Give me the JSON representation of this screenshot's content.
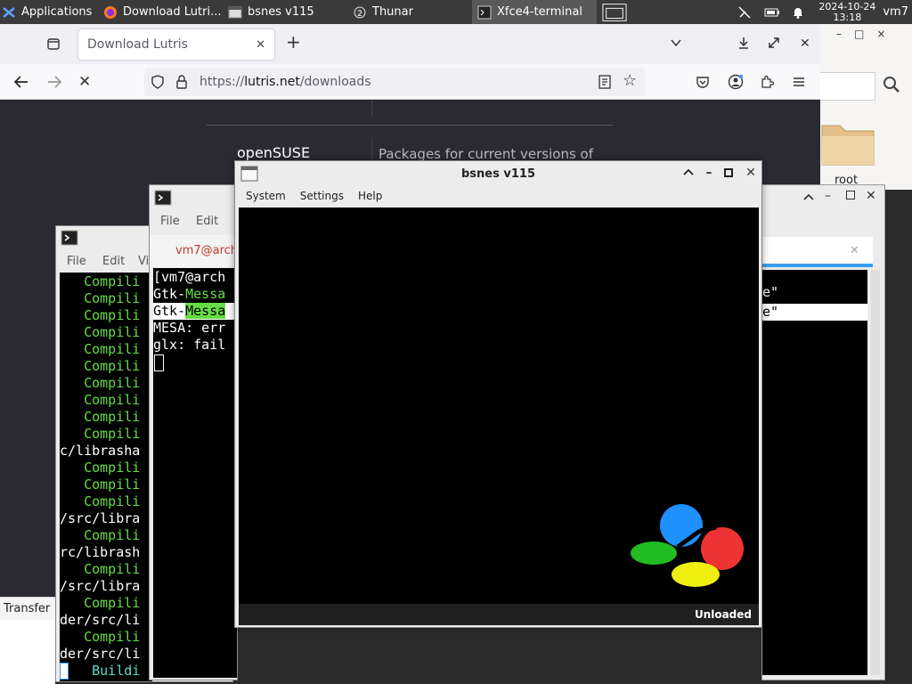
{
  "taskbar": {
    "apps_label": "Applications",
    "items": [
      {
        "label": "Download Lutri..."
      },
      {
        "label": "bsnes v115"
      },
      {
        "label": "Thunar"
      },
      {
        "label": "Xfce4-terminal"
      }
    ],
    "date": "2024-10-24",
    "time": "13:18",
    "user": "vm7"
  },
  "firefox": {
    "tab_title": "Download Lutris",
    "url_prefix": "https://",
    "url_domain": "lutris.net",
    "url_path": "/downloads",
    "page_heading": "openSUSE",
    "page_text": "Packages for current versions of"
  },
  "thunar": {
    "folder_label": "root"
  },
  "transfer_label": "Transfer",
  "term_back": {
    "menu": [
      "File",
      "Edit",
      "Vi"
    ],
    "lines": [
      {
        "pre": "   ",
        "g": "Compili",
        "post": ""
      },
      {
        "pre": "   ",
        "g": "Compili",
        "post": ""
      },
      {
        "pre": "   ",
        "g": "Compili",
        "post": ""
      },
      {
        "pre": "   ",
        "g": "Compili",
        "post": ""
      },
      {
        "pre": "   ",
        "g": "Compili",
        "post": ""
      },
      {
        "pre": "   ",
        "g": "Compili",
        "post": ""
      },
      {
        "pre": "   ",
        "g": "Compili",
        "post": ""
      },
      {
        "pre": "   ",
        "g": "Compili",
        "post": ""
      },
      {
        "pre": "   ",
        "g": "Compili",
        "post": ""
      },
      {
        "pre": "   ",
        "g": "Compili",
        "post": ""
      },
      {
        "pre": "c/librasha",
        "g": "",
        "post": ""
      },
      {
        "pre": "   ",
        "g": "Compili",
        "post": ""
      },
      {
        "pre": "   ",
        "g": "Compili",
        "post": ""
      },
      {
        "pre": "   ",
        "g": "Compili",
        "post": ""
      },
      {
        "pre": "/src/libra",
        "g": "",
        "post": ""
      },
      {
        "pre": "   ",
        "g": "Compili",
        "post": ""
      },
      {
        "pre": "rc/librash",
        "g": "",
        "post": ""
      },
      {
        "pre": "   ",
        "g": "Compili",
        "post": ""
      },
      {
        "pre": "/src/libra",
        "g": "",
        "post": ""
      },
      {
        "pre": "   ",
        "g": "Compili",
        "post": ""
      },
      {
        "pre": "der/src/li",
        "g": "",
        "post": ""
      },
      {
        "pre": "   ",
        "g": "Compili",
        "post": ""
      },
      {
        "pre": "der/src/li",
        "g": "",
        "post": ""
      },
      {
        "pre": "    ",
        "g": "Buildi",
        "post": ""
      }
    ]
  },
  "term_mid": {
    "menu": [
      "File",
      "Edit"
    ],
    "tab_label": "vm7@arch",
    "lines": [
      {
        "pre": "[vm7@arch",
        "g": "",
        "post": ""
      },
      {
        "pre": "Gtk-",
        "g": "Messa",
        "post": ""
      },
      {
        "pre": "Gtk-",
        "g": "Messa",
        "post": ""
      },
      {
        "pre": "MESA: err",
        "g": "",
        "post": ""
      },
      {
        "pre": "glx: fail",
        "g": "",
        "post": ""
      }
    ],
    "right_frag_1": "e\"",
    "right_frag_2": "e\""
  },
  "bsnes": {
    "title": "bsnes v115",
    "menu": [
      "System",
      "Settings",
      "Help"
    ],
    "status": "Unloaded"
  }
}
